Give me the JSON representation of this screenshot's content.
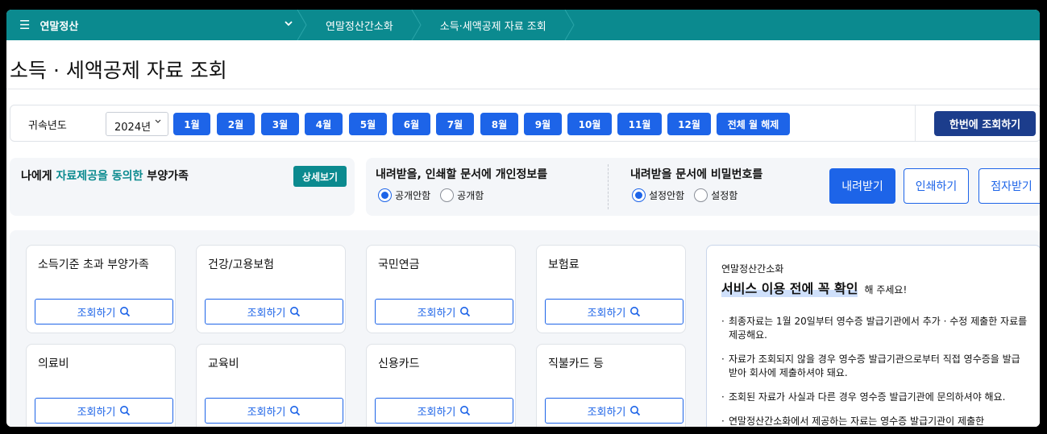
{
  "nav": {
    "menu_label": "연말정산",
    "breadcrumbs": [
      "연말정산간소화",
      "소득·세액공제 자료 조회"
    ]
  },
  "page": {
    "title": "소득 · 세액공제 자료 조회"
  },
  "year_filter": {
    "label": "귀속년도",
    "year_value": "2024년",
    "months": [
      "1월",
      "2월",
      "3월",
      "4월",
      "5월",
      "6월",
      "7월",
      "8월",
      "9월",
      "10월",
      "11월",
      "12월"
    ],
    "clear_label": "전체 월 해제",
    "query_all_label": "한번에 조회하기"
  },
  "dependents": {
    "text_prefix": "나에게 ",
    "text_highlight": "자료제공을 동의한",
    "text_suffix": " 부양가족",
    "detail_label": "상세보기"
  },
  "download_options": {
    "privacy": {
      "title": "내려받을, 인쇄할 문서에 개인정보를",
      "options": [
        "공개안함",
        "공개함"
      ],
      "selected": "공개안함"
    },
    "password": {
      "title": "내려받을 문서에 비밀번호를",
      "options": [
        "설정안함",
        "설정함"
      ],
      "selected": "설정안함"
    },
    "download_label": "내려받기",
    "print_label": "인쇄하기",
    "braille_label": "점자받기"
  },
  "cards": [
    {
      "title": "소득기준 초과 부양가족",
      "button": "조회하기"
    },
    {
      "title": "건강/고용보험",
      "button": "조회하기"
    },
    {
      "title": "국민연금",
      "button": "조회하기"
    },
    {
      "title": "보험료",
      "button": "조회하기"
    },
    {
      "title": "의료비",
      "button": "조회하기"
    },
    {
      "title": "교육비",
      "button": "조회하기"
    },
    {
      "title": "신용카드",
      "button": "조회하기"
    },
    {
      "title": "직불카드 등",
      "button": "조회하기"
    }
  ],
  "notice": {
    "subtitle": "연말정산간소화",
    "headline": "서비스 이용 전에 꼭 확인",
    "headline_rest": "해 주세요!",
    "items": [
      "최종자료는 1월 20일부터 영수증 발급기관에서 추가 · 수정 제출한 자료를 제공해요.",
      "자료가 조회되지 않을 경우 영수증 발급기관으로부터 직접 영수증을 발급받아 회사에 제출하셔야 돼요.",
      "조회된 자료가 사실과 다른 경우 영수증 발급기관에 문의하셔야 해요.",
      "연말정산간소화에서 제공하는 자료는 영수증 발급기관이 제출한"
    ]
  },
  "colors": {
    "teal": "#0b8a8f",
    "primary_blue": "#1d64e8",
    "navy": "#1c3d8c",
    "panel_bg": "#f4f6f9"
  }
}
